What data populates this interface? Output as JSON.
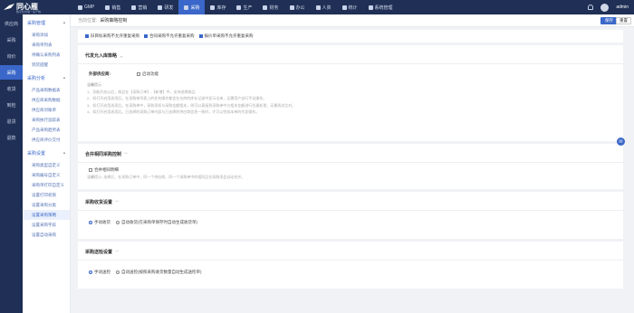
{
  "brand": {
    "name": "同心雁",
    "sub": "数字化管理一生产统"
  },
  "topnav": [
    {
      "label": "GMP",
      "active": false
    },
    {
      "label": "销售",
      "active": false
    },
    {
      "label": "营销",
      "active": false
    },
    {
      "label": "研发",
      "active": false
    },
    {
      "label": "采购",
      "active": true
    },
    {
      "label": "库存",
      "active": false
    },
    {
      "label": "生产",
      "active": false
    },
    {
      "label": "财务",
      "active": false
    },
    {
      "label": "办公",
      "active": false
    },
    {
      "label": "人资",
      "active": false
    },
    {
      "label": "统计",
      "active": false
    },
    {
      "label": "系统管理",
      "active": false
    }
  ],
  "user": {
    "name": "admin"
  },
  "rail": [
    "供应商",
    "采购",
    "询价",
    "采购",
    "收货",
    "到检",
    "退货",
    "退款"
  ],
  "subnav": {
    "group1": "采购管理",
    "group1_items": [
      "采购添加",
      "采购单列表",
      "待确认采购列表",
      "到货提醒"
    ],
    "group2": "采购分析",
    "group2_items": [
      "产品采购数据表",
      "供应商采购数据",
      "供应商对账单",
      "采购执行追踪表",
      "产品采购趋势表",
      "供应商评价交付"
    ],
    "group3": "采购设置",
    "group3_items": [
      "采购类型自定义",
      "采购编号自定义",
      "采购单打印自定义",
      "设置打印权限",
      "设置采购分类",
      "设置采购策略",
      "设置采购字段",
      "设置自动采购"
    ]
  },
  "breadcrumb": {
    "label": "当前位置:",
    "current": "采购策略控制"
  },
  "buttons": {
    "save": "保存",
    "reset": "重置"
  },
  "top_checks": [
    {
      "label": "旧目标采购不允许重复采购",
      "checked": true
    },
    {
      "label": "合同采购不允许重复采购",
      "checked": true
    },
    {
      "label": "报价单采购不允许重复采购",
      "checked": true
    }
  ],
  "sec1": {
    "title": "代发允入库策略",
    "field_label": "外部供应商:",
    "option": "启动功能",
    "hint_head": "温馨提示:",
    "hints": [
      "1、功能开启以后，商品在【采购订单】-【新增】中，支持选择商品.",
      "2、如打开启用选项后。在采购单列表上的任何操作都会在仓库的库存记录中显示出来，无需用户自行手动操作。",
      "3、如打开启用选项后。在采购单中，采购项如与采购金额相关，则可以直接到采购单中与相关金额进行拉通处理，无需再次比对。",
      "4、如打开启用选项后。已选择的采购订单内容与已选择的供应商信息一致时，才可以完成本单的代发操作。"
    ]
  },
  "sec2": {
    "title": "合并相同采购控制",
    "option": "合并相同明细",
    "hint": "温馨提示: 选择后，在采购订单中，同一个供应商、同一个采购单中的相同品名采购项会自动合并。"
  },
  "sec3": {
    "title": "采购收货设置",
    "options": [
      {
        "label": "手动收货",
        "checked": true
      },
      {
        "label": "自动收货(在采购单保存时自动生成收货单)",
        "checked": false
      }
    ]
  },
  "sec4": {
    "title": "采购送检设置",
    "options": [
      {
        "label": "手动送检",
        "checked": true
      },
      {
        "label": "自动送检(按照采购收货数量自动生成送检单)",
        "checked": false
      }
    ]
  }
}
